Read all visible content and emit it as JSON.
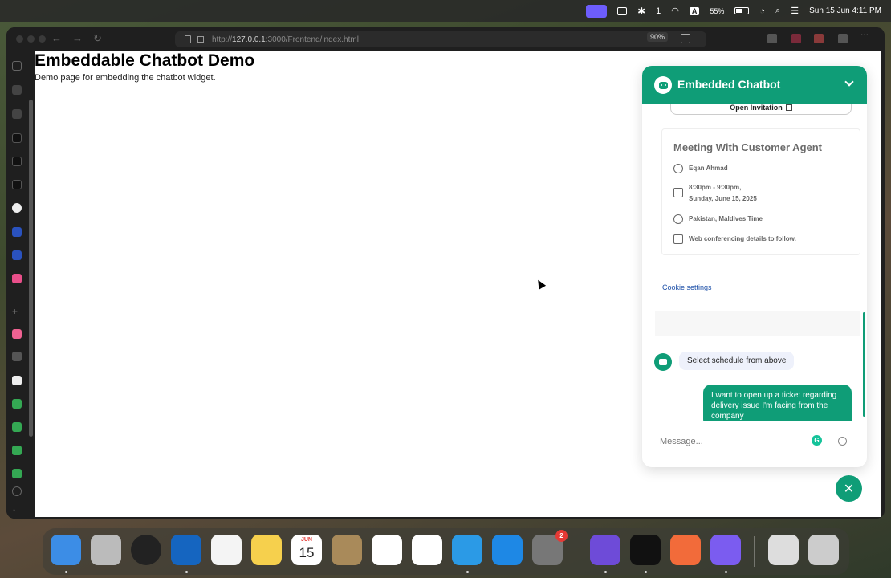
{
  "menubar": {
    "input_indicator": "1",
    "input_source": "A",
    "battery": "55%",
    "datetime": "Sun 15 Jun  4:11 PM"
  },
  "browser": {
    "url_prefix": "http://",
    "url_host": "127.0.0.1",
    "url_rest": ":3000/Frontend/index.html",
    "zoom": "90%"
  },
  "page": {
    "title": "Embeddable Chatbot Demo",
    "subtitle": "Demo page for embedding the chatbot widget."
  },
  "chatbot": {
    "title": "Embedded Chatbot",
    "open_invitation": "Open Invitation",
    "meeting": {
      "title": "Meeting With Customer Agent",
      "host": "Eqan Ahmad",
      "time_line1": "8:30pm - 9:30pm,",
      "time_line2": "Sunday, June 15, 2025",
      "timezone": "Pakistan, Maldives Time",
      "conferencing": "Web conferencing details to follow."
    },
    "cookie_settings": "Cookie settings",
    "bot_message": "Select schedule from above",
    "user_message": "I want to open up a ticket regarding delivery issue I'm facing from the company",
    "input_placeholder": "Message...",
    "grammarly_letter": "G",
    "close_glyph": "✕"
  },
  "dock": {
    "calendar_month": "JUN",
    "calendar_day": "15",
    "settings_badge": "2"
  },
  "colors": {
    "accent": "#0f9d77",
    "link": "#1c4fa8"
  }
}
